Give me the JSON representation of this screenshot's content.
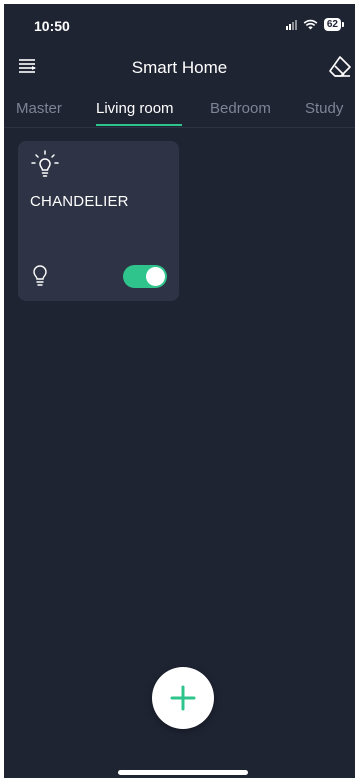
{
  "status_bar": {
    "time": "10:50",
    "battery": "62"
  },
  "header": {
    "title": "Smart Home",
    "menu_icon": "menu-icon",
    "right_icon": "eraser-icon"
  },
  "tabs": [
    {
      "label": "Master",
      "active": false
    },
    {
      "label": "Living room",
      "active": true
    },
    {
      "label": "Bedroom",
      "active": false
    },
    {
      "label": "Study",
      "active": false
    }
  ],
  "devices": [
    {
      "name": "CHANDELIER",
      "icon": "bulb-rays-icon",
      "status_icon": "bulb-icon",
      "on": true
    }
  ],
  "fab": {
    "icon": "plus-icon"
  },
  "colors": {
    "background": "#1f2433",
    "card": "#2e3445",
    "accent": "#2ec48b",
    "tab_inactive": "#7d8496"
  }
}
